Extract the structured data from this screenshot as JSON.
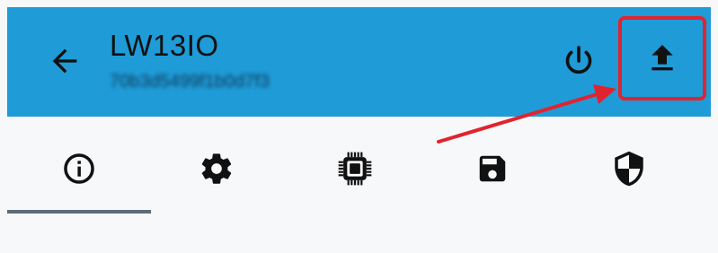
{
  "app_bar": {
    "device_name": "LW13IO",
    "device_id": "70b3d5499f1b0d7f3",
    "background_color": "#1f9bd7",
    "back_icon": "arrow-left-icon",
    "power_icon": "power-icon",
    "upload_icon": "upload-icon"
  },
  "annotation": {
    "highlight_color": "#e0242f",
    "target": "upload-button"
  },
  "tabs": {
    "selected": "info",
    "items": [
      {
        "key": "info",
        "icon": "info-circle-icon"
      },
      {
        "key": "settings",
        "icon": "gear-icon"
      },
      {
        "key": "hardware",
        "icon": "chip-icon"
      },
      {
        "key": "save",
        "icon": "floppy-disk-icon"
      },
      {
        "key": "security",
        "icon": "shield-icon"
      }
    ],
    "indicator_color": "#5c6a78"
  }
}
